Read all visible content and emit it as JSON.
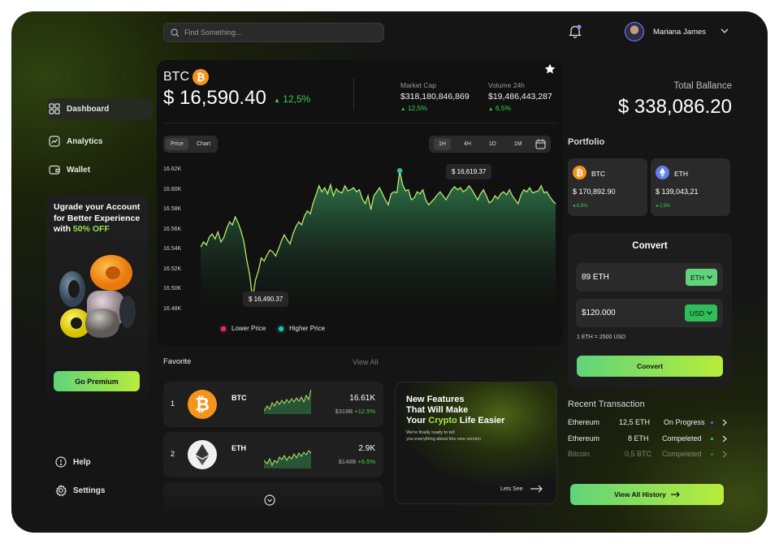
{
  "search": {
    "placeholder": "Find Something..."
  },
  "user": {
    "name": "Mariana James"
  },
  "sidebar": {
    "items": [
      {
        "label": "Dashboard"
      },
      {
        "label": "Analytics"
      },
      {
        "label": "Wallet"
      }
    ],
    "bottom": [
      {
        "label": "Help"
      },
      {
        "label": "Settings"
      }
    ],
    "upgrade": {
      "line1": "Ugrade your Account",
      "line2": "for Better Experience",
      "line3_prefix": "with ",
      "line3_highlight": "50% OFF",
      "button": "Go Premium"
    }
  },
  "coin": {
    "symbol": "BTC",
    "price": "$ 16,590.40",
    "change": "12,5%",
    "market_cap_label": "Market Cap",
    "market_cap_value": "$318,180,846,869",
    "market_cap_change": "12,5%",
    "volume_label": "Volume 24h",
    "volume_value": "$19,486,443,287",
    "volume_change": "6,5%"
  },
  "chart_toggle": {
    "left": "Price",
    "right": "Chart"
  },
  "timeframes": [
    "1H",
    "4H",
    "1D",
    "1M"
  ],
  "chart_data": {
    "type": "area",
    "y_ticks": [
      "16.62K",
      "16.60K",
      "16.58K",
      "16.56K",
      "16.54K",
      "16.52K",
      "16.50K",
      "16.48K"
    ],
    "ylim": [
      16.48,
      16.62
    ],
    "high_label": "$ 16,619.37",
    "low_label": "$ 16,490.37",
    "legend": [
      {
        "name": "Lower Price",
        "color": "#e0306a"
      },
      {
        "name": "Higher Price",
        "color": "#22c3b0"
      }
    ],
    "series": [
      {
        "values": [
          16.543,
          16.548,
          16.545,
          16.553,
          16.556,
          16.551,
          16.558,
          16.548,
          16.552,
          16.561,
          16.568,
          16.565,
          16.573,
          16.567,
          16.559,
          16.548,
          16.53,
          16.515,
          16.491,
          16.51,
          16.519,
          16.532,
          16.529,
          16.535,
          16.54,
          16.538,
          16.534,
          16.541,
          16.549,
          16.555,
          16.55,
          16.546,
          16.556,
          16.563,
          16.568,
          16.565,
          16.574,
          16.579,
          16.576,
          16.587,
          16.595,
          16.604,
          16.598,
          16.602,
          16.596,
          16.605,
          16.594,
          16.601,
          16.598,
          16.597,
          16.604,
          16.599,
          16.6,
          16.602,
          16.598,
          16.6,
          16.591,
          16.586,
          16.594,
          16.58,
          16.594,
          16.598,
          16.602,
          16.596,
          16.59,
          16.585,
          16.596,
          16.598,
          16.597,
          16.619,
          16.605,
          16.599,
          16.6,
          16.59,
          16.592,
          16.598,
          16.596,
          16.6,
          16.59,
          16.585,
          16.588,
          16.591,
          16.595,
          16.598,
          16.594,
          16.59,
          16.595,
          16.6,
          16.603,
          16.6,
          16.602,
          16.598,
          16.6,
          16.604,
          16.6,
          16.595,
          16.59,
          16.596,
          16.6,
          16.594,
          16.587,
          16.589,
          16.594,
          16.591,
          16.596,
          16.598,
          16.595,
          16.6,
          16.594,
          16.59,
          16.586,
          16.595,
          16.6,
          16.598,
          16.602,
          16.597,
          16.598,
          16.599,
          16.604,
          16.597,
          16.598,
          16.593,
          16.589,
          16.586
        ]
      }
    ]
  },
  "favorite": {
    "title": "Favorite",
    "view_all": "View All",
    "rows": [
      {
        "num": "1",
        "symbol": "BTC",
        "price": "16.61K",
        "cap": "$318B",
        "change": "+12.5%"
      },
      {
        "num": "2",
        "symbol": "ETH",
        "price": "2.9K",
        "cap": "$148B",
        "change": "+6.5%"
      }
    ]
  },
  "promo": {
    "line1": "New Features",
    "line2": "That Will Make",
    "line3_prefix": "Your ",
    "line3_highlight": "Crypto",
    "line3_suffix": " Life Easier",
    "sub1": "We're finally ready to tell",
    "sub2": "you everything about this new version",
    "cta": "Lets See"
  },
  "balance": {
    "label": "Total Ballance",
    "value": "$ 338,086.20"
  },
  "portfolio": {
    "title": "Portfolio",
    "cards": [
      {
        "symbol": "BTC",
        "value": "$ 170,892.90",
        "change": "6,5%"
      },
      {
        "symbol": "ETH",
        "value": "$ 139,043,21",
        "change": "2,5%"
      }
    ]
  },
  "convert": {
    "title": "Convert",
    "from_value": "89 ETH",
    "from_currency": "ETH",
    "to_value": "$120.000",
    "to_currency": "USD",
    "rate": "1 ETH = 2500 USD",
    "button": "Convert"
  },
  "transactions": {
    "title": "Recent Transaction",
    "rows": [
      {
        "coin": "Ethereum",
        "amount": "12,5 ETH",
        "status": "On Progress",
        "dot": "#7a5cff"
      },
      {
        "coin": "Ethereum",
        "amount": "8 ETH",
        "status": "Compeleted",
        "dot": "#38d24a"
      },
      {
        "coin": "Bitcoin",
        "amount": "0,5 BTC",
        "status": "Compeleted",
        "dot": "#38d24a"
      }
    ],
    "view_all": "View All History"
  }
}
